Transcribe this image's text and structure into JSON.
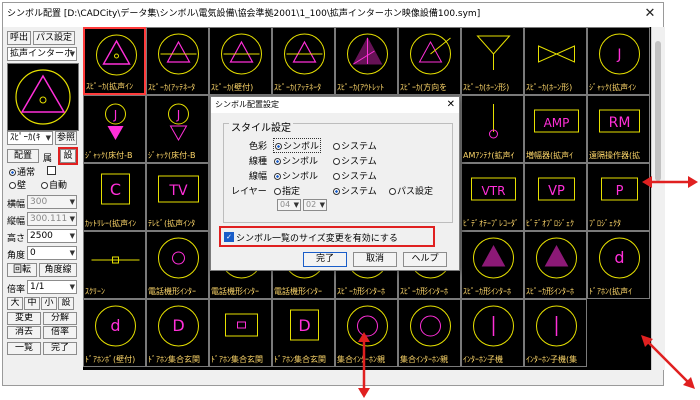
{
  "window": {
    "title": "シンボル配置 [D:\\CADCity\\データ集\\シンボル\\電気設備\\協会準拠2001\\1_100\\拡声インターホン映像設備100.sym]",
    "close_label": "✕"
  },
  "sidebar": {
    "call_label": "呼出",
    "path_label": "パス設定",
    "symbol_dropdown": "拡声インターホ",
    "name_field": "ｽﾋﾟｰｶ(ｷ",
    "ref_label": "参照",
    "place_label": "配置",
    "attr_label": "属",
    "set_label": "設",
    "mode_normal": "通常",
    "mode_wall": "壁",
    "mode_auto": "自動",
    "scale_x_label": "横幅",
    "scale_x_value": "300",
    "scale_y_label": "縦幅",
    "scale_y_value": "300.111",
    "height_label": "高さ",
    "height_value": "2500",
    "angle_label": "角度",
    "angle_value": "0",
    "rotate_label": "回転",
    "angle_line_label": "角度線",
    "ratio_label": "倍率",
    "ratio_value": "1/1",
    "size_large": "大",
    "size_mid": "中",
    "size_small": "小",
    "size_set": "設",
    "change_label": "変更",
    "explode_label": "分解",
    "erase_label": "消去",
    "ratio_btn_label": "倍率",
    "list_label": "一覧",
    "done_label": "完了"
  },
  "symbols": [
    {
      "caption": "ｽﾋﾟｰｶ(拡声ｲﾝ",
      "icon": "speaker-triangle-icon",
      "selected": true
    },
    {
      "caption": "ｽﾋﾟｰｶ(ｱｯﾃﾈｰﾀ",
      "icon": "speaker-att-icon"
    },
    {
      "caption": "ｽﾋﾟｰｶ(壁付)",
      "icon": "speaker-wall-icon"
    },
    {
      "caption": "ｽﾋﾟｰｶ(ｱｯﾃﾈｰﾀ",
      "icon": "speaker-att2-icon"
    },
    {
      "caption": "ｽﾋﾟｰｶ(ｱｳﾄﾚｯﾄ",
      "icon": "speaker-outlet-icon"
    },
    {
      "caption": "ｽﾋﾟｰｶ(方向を",
      "icon": "speaker-direction-icon"
    },
    {
      "caption": "ｽﾋﾟｰｶ(ﾎｰﾝ形)",
      "icon": "horn-icon"
    },
    {
      "caption": "ｽﾋﾟｰｶ(ﾎｰﾝ形)",
      "icon": "horn2-icon"
    },
    {
      "caption": "ｼﾞｬｯｸ(拡声ｲﾝ",
      "icon": "jack-icon"
    },
    {
      "caption": "ｼﾞｬｯｸ(床付-B",
      "icon": "jack-floor-icon"
    },
    {
      "caption": "ｼﾞｬｯｸ(床付-B",
      "icon": "jack-floor2-icon"
    },
    {
      "caption": "",
      "icon": "blank-icon"
    },
    {
      "caption": "",
      "icon": "blank-icon"
    },
    {
      "caption": "",
      "icon": "blank-icon"
    },
    {
      "caption": "",
      "icon": "blank-icon"
    },
    {
      "caption": "AMｱﾝﾃﾅ(拡声ｲ",
      "icon": "antenna-icon"
    },
    {
      "caption": "増幅器(拡声ｲ",
      "icon": "amp-box-icon"
    },
    {
      "caption": "遠隔操作器(拡",
      "icon": "rm-box-icon"
    },
    {
      "caption": "ｶｯﾄﾘﾚｰ(拡声ｲﾝ",
      "icon": "cut-relay-icon"
    },
    {
      "caption": "ﾃﾚﾋﾞ(拡声ｲﾝﾀ",
      "icon": "tv-icon"
    },
    {
      "caption": "",
      "icon": "blank-icon"
    },
    {
      "caption": "",
      "icon": "blank-icon"
    },
    {
      "caption": "",
      "icon": "blank-icon"
    },
    {
      "caption": "",
      "icon": "blank-icon"
    },
    {
      "caption": "ﾋﾞﾃﾞｵﾃｰﾌﾟﾚｺｰﾀﾞ",
      "icon": "vtr-icon"
    },
    {
      "caption": "ﾋﾞﾃﾞｵﾌﾟﾛｼﾞｪｸ",
      "icon": "vp-icon"
    },
    {
      "caption": "ﾌﾟﾛｼﾞｪｸﾀ",
      "icon": "projector-icon"
    },
    {
      "caption": "ｽｸﾘｰﾝ",
      "icon": "screen-icon"
    },
    {
      "caption": "電話機形ｲﾝﾀｰ",
      "icon": "phone-icon"
    },
    {
      "caption": "電話機形ｲﾝﾀｰ",
      "icon": "phone2-icon"
    },
    {
      "caption": "電話機形ｲﾝﾀｰ",
      "icon": "phone3-icon"
    },
    {
      "caption": "ｽﾋﾟｰｶ形ｲﾝﾀｰﾎ",
      "icon": "speaker-inter-icon"
    },
    {
      "caption": "ｽﾋﾟｰｶ形ｲﾝﾀｰﾎ",
      "icon": "speaker-inter2-icon"
    },
    {
      "caption": "ｽﾋﾟｰｶ形ｲﾝﾀｰﾎ",
      "icon": "speaker-inter3-icon"
    },
    {
      "caption": "ｽﾋﾟｰｶ形ｲﾝﾀｰﾎ",
      "icon": "speaker-inter4-icon"
    },
    {
      "caption": "ﾄﾞｱﾎﾝ(拡声ｲ",
      "icon": "doorphone-icon"
    },
    {
      "caption": "ﾄﾞｱﾎﾝﾎﾞ(壁付)",
      "icon": "doorphone-wall-icon"
    },
    {
      "caption": "ﾄﾞｱﾎﾝ集合玄関",
      "icon": "doorphone-set-icon"
    },
    {
      "caption": "ﾄﾞｱﾎﾝ集合玄関",
      "icon": "doorphone-set2-icon"
    },
    {
      "caption": "ﾄﾞｱﾎﾝ集合玄関",
      "icon": "doorphone-set3-icon"
    },
    {
      "caption": "集合ｲﾝﾀｰﾎﾝ親",
      "icon": "master-icon"
    },
    {
      "caption": "集合ｲﾝﾀｰﾎﾝ親",
      "icon": "master2-icon"
    },
    {
      "caption": "ｲﾝﾀｰﾎﾝ子機",
      "icon": "slave-icon"
    },
    {
      "caption": "ｲﾝﾀｰﾎﾝ子機(集",
      "icon": "slave2-icon"
    }
  ],
  "dialog": {
    "title": "シンボル配置設定",
    "close_label": "✕",
    "style_heading": "スタイル設定",
    "color_label": "色彩",
    "linetype_label": "線種",
    "linewidth_label": "線幅",
    "layer_label": "レイヤー",
    "opt_symbol": "シンボル",
    "opt_system": "システム",
    "opt_specify": "指定",
    "opt_path": "パス設定",
    "layer_sel_1": "04",
    "layer_sel_2": "02",
    "checkbox_label": "シンボル一覧のサイズ変更を有効にする",
    "ok_label": "完了",
    "cancel_label": "取消",
    "help_label": "ヘルプ"
  },
  "colors": {
    "symbol_line": "#e6e000",
    "symbol_accent": "#ff2fd8",
    "caption": "#ffd86a",
    "highlight": "#e02020"
  }
}
